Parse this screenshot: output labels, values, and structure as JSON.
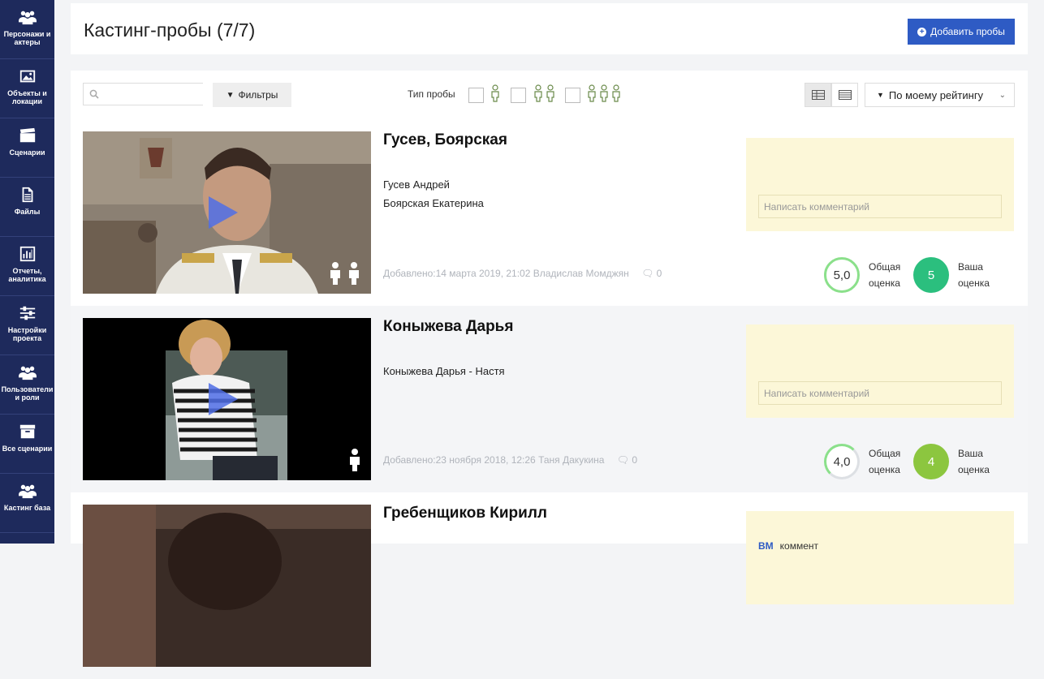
{
  "sidebar": {
    "items": [
      {
        "label": "Персонажи и актеры",
        "icon": "users-icon"
      },
      {
        "label": "Объекты и локации",
        "icon": "image-icon"
      },
      {
        "label": "Сценарии",
        "icon": "clapperboard-icon"
      },
      {
        "label": "Файлы",
        "icon": "file-icon"
      },
      {
        "label": "Отчеты, аналитика",
        "icon": "bar-chart-icon"
      },
      {
        "label": "Настройки проекта",
        "icon": "sliders-icon"
      },
      {
        "label": "Пользователи и роли",
        "icon": "users-icon"
      },
      {
        "label": "Все сценарии",
        "icon": "archive-icon"
      },
      {
        "label": "Кастинг база",
        "icon": "users-icon"
      }
    ]
  },
  "header": {
    "title": "Кастинг-пробы (7/7)",
    "add_button": "Добавить пробы"
  },
  "toolbar": {
    "search_placeholder": "",
    "filters_label": "Фильтры",
    "type_label": "Тип пробы",
    "sort_label": "По моему рейтингу"
  },
  "colors": {
    "sidebar": "#1e2a5c",
    "accent": "#2e5bc4",
    "comment_bg": "#fcf7d8",
    "rating_green": "#2bbf7e",
    "rating_lime": "#8cc63f"
  },
  "rows": [
    {
      "title": "Гусев, Боярская",
      "actors": [
        "Гусев Андрей",
        "Боярская Екатерина"
      ],
      "people_count": 2,
      "added": "Добавлено:14 марта 2019, 21:02",
      "author": "Владислав Момджян",
      "comments": "0",
      "comment_placeholder": "Написать комментарий",
      "total_rating": "5,0",
      "total_fill": 1.0,
      "my_rating": "5",
      "total_label_1": "Общая",
      "total_label_2": "оценка",
      "mine_label_1": "Ваша",
      "mine_label_2": "оценка"
    },
    {
      "title": "Коныжева Дарья",
      "actors": [
        "Коныжева Дарья - Настя"
      ],
      "people_count": 1,
      "added": "Добавлено:23 ноября 2018, 12:26",
      "author": "Таня Дакукина",
      "comments": "0",
      "comment_placeholder": "Написать комментарий",
      "total_rating": "4,0",
      "total_fill": 0.8,
      "my_rating": "4",
      "total_label_1": "Общая",
      "total_label_2": "оценка",
      "mine_label_1": "Ваша",
      "mine_label_2": "оценка"
    },
    {
      "title": "Гребенщиков Кирилл",
      "comment_author": "ВМ",
      "comment_text": "коммент"
    }
  ]
}
